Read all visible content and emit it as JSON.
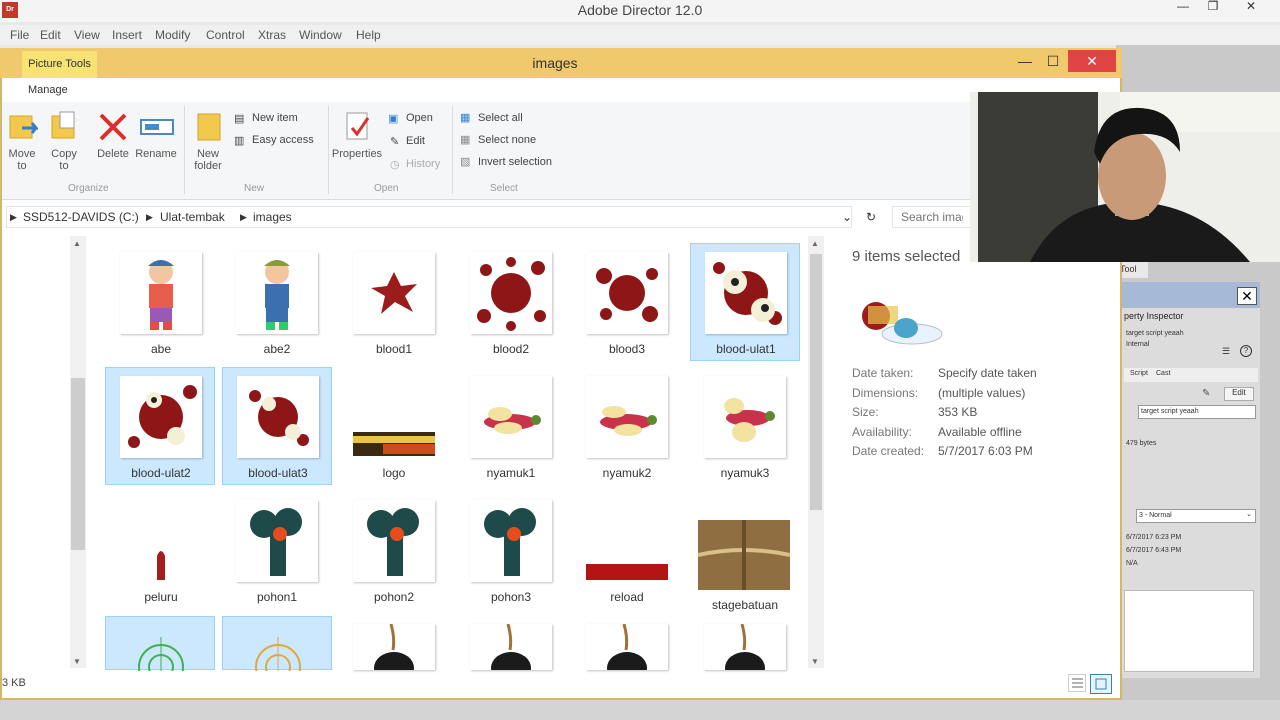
{
  "app": {
    "title": "Adobe Director 12.0",
    "logo": "Dr",
    "menu": [
      "File",
      "Edit",
      "View",
      "Insert",
      "Modify",
      "Control",
      "Xtras",
      "Window",
      "Help"
    ]
  },
  "explorer": {
    "context_tab": "Picture Tools",
    "title": "images",
    "ribbon_tab": "Manage",
    "ribbon": {
      "move_to": "Move to",
      "copy_to": "Copy to",
      "delete": "Delete",
      "rename": "Rename",
      "organize": "Organize",
      "new_folder": "New folder",
      "new_item": "New item",
      "easy_access": "Easy access",
      "new": "New",
      "properties": "Properties",
      "open": "Open",
      "edit": "Edit",
      "history": "History",
      "open_group": "Open",
      "select_all": "Select all",
      "select_none": "Select none",
      "invert_selection": "Invert selection",
      "select_group": "Select"
    },
    "breadcrumb": [
      "SSD512-DAVIDS (C:)",
      "Ulat-tembak",
      "images"
    ],
    "search_placeholder": "Search images",
    "files": [
      {
        "name": "abe",
        "selected": false
      },
      {
        "name": "abe2",
        "selected": false
      },
      {
        "name": "blood1",
        "selected": false
      },
      {
        "name": "blood2",
        "selected": false
      },
      {
        "name": "blood3",
        "selected": false
      },
      {
        "name": "blood-ulat1",
        "selected": true
      },
      {
        "name": "blood-ulat2",
        "selected": true
      },
      {
        "name": "blood-ulat3",
        "selected": true
      },
      {
        "name": "logo",
        "selected": false
      },
      {
        "name": "nyamuk1",
        "selected": false
      },
      {
        "name": "nyamuk2",
        "selected": false
      },
      {
        "name": "nyamuk3",
        "selected": false
      },
      {
        "name": "peluru",
        "selected": false
      },
      {
        "name": "pohon1",
        "selected": false
      },
      {
        "name": "pohon2",
        "selected": false
      },
      {
        "name": "pohon3",
        "selected": false
      },
      {
        "name": "reload",
        "selected": false
      },
      {
        "name": "stagebatuan",
        "selected": false
      }
    ],
    "details": {
      "count": "9 items selected",
      "rows": [
        {
          "key": "Date taken:",
          "value": "Specify date taken"
        },
        {
          "key": "Dimensions:",
          "value": "(multiple values)"
        },
        {
          "key": "Size:",
          "value": "353 KB"
        },
        {
          "key": "Availability:",
          "value": "Available offline"
        },
        {
          "key": "Date created:",
          "value": "5/7/2017 6:03 PM"
        }
      ]
    },
    "status": "3 KB"
  },
  "property_inspector": {
    "tab": "Tool",
    "title": "perty Inspector",
    "member_name": "target script yeaah",
    "location": "Internal",
    "tabs": [
      "Script",
      "Cast"
    ],
    "edit": "Edit",
    "name_value": "target script yeaah",
    "size": "479 bytes",
    "ink": "3 - Normal",
    "created": "6/7/2017 6:23 PM",
    "modified": "6/7/2017 6:43 PM",
    "modified_by": "N/A"
  },
  "colors": {
    "explorer_title": "#f0c96d",
    "selection": "#cce8ff",
    "close_red": "#e04343"
  }
}
